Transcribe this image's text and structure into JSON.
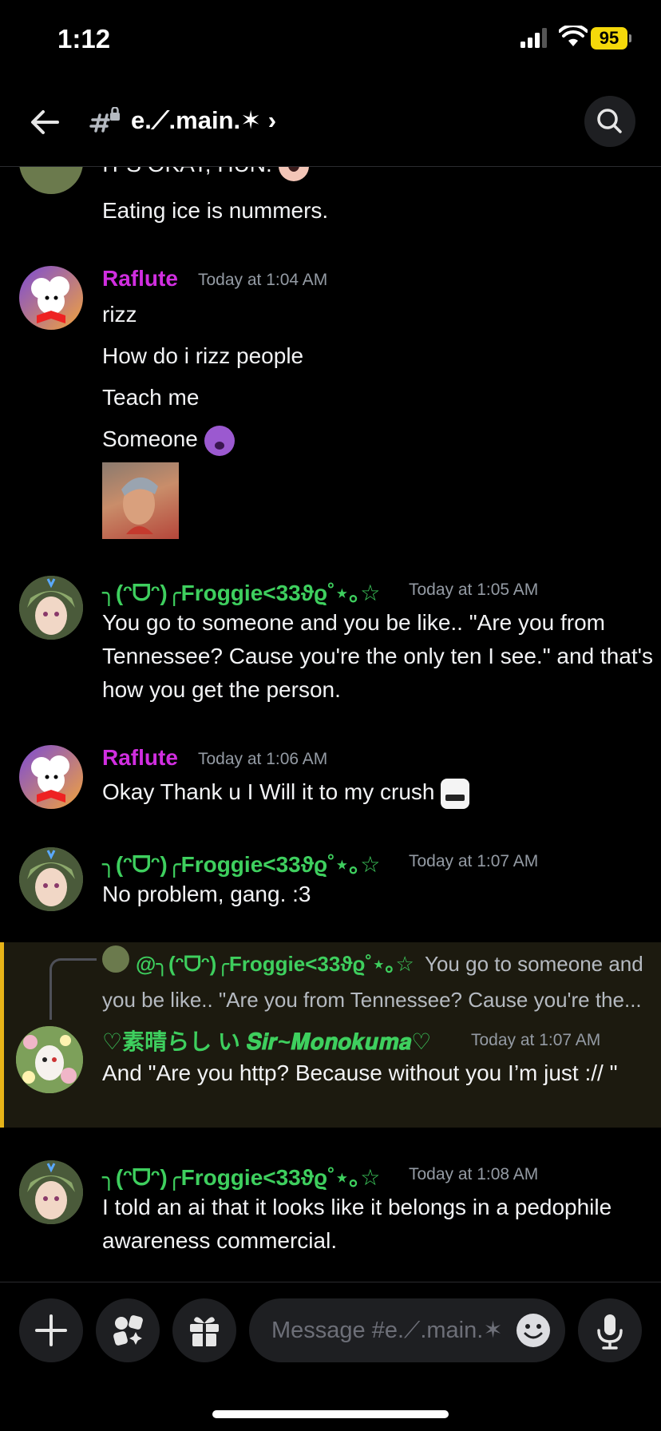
{
  "status_bar": {
    "time": "1:12",
    "battery": "95"
  },
  "header": {
    "channel_name": "e.⟋.main.✶ ›"
  },
  "messages": [
    {
      "text1": "IT'S OKAY, HUN.",
      "text2": "Eating ice is nummers."
    },
    {
      "username": "Raflute",
      "timestamp": "Today at 1:04 AM",
      "lines": [
        "rizz",
        "How do i rizz people",
        "Teach me",
        "Someone"
      ]
    },
    {
      "username": "╮(ᵔᗜᵔ)╭Froggie<33ϑϱ˚⋆｡☆",
      "timestamp": "Today at 1:05 AM",
      "text": "You go to someone and you be like.. \"Are you from Tennessee? Cause you're the only ten I see.\" and that's how you get the person."
    },
    {
      "username": "Raflute",
      "timestamp": "Today at 1:06 AM",
      "text": "Okay Thank u I Will it to my crush"
    },
    {
      "username": "╮(ᵔᗜᵔ)╭Froggie<33ϑϱ˚⋆｡☆",
      "timestamp": "Today at 1:07 AM",
      "text": "No problem, gang. :3"
    },
    {
      "reply_mention": "@╮(ᵔᗜᵔ)╭Froggie<33ϑϱ˚⋆｡☆",
      "reply_preview_1": "You go to someone and",
      "reply_preview_2": "you be like.. \"Are you from Tennessee? Cause you're the...",
      "username": "♡素晴らし い 𝑺𝒊𝒓~𝑴𝒐𝒏𝒐𝒌𝒖𝒎𝒂♡",
      "timestamp": "Today at 1:07 AM",
      "text": "And \"Are you http? Because without you I’m just :// \""
    },
    {
      "username": "╮(ᵔᗜᵔ)╭Froggie<33ϑϱ˚⋆｡☆",
      "timestamp": "Today at 1:08 AM",
      "text": "I told an ai that it looks like it belongs in a pedophile awareness commercial."
    }
  ],
  "composer": {
    "placeholder": "Message #e.⟋.main.✶"
  },
  "colors": {
    "raflute": "#d12ee0",
    "froggie": "#3ecf5e",
    "reply_highlight": "#e7b418"
  }
}
